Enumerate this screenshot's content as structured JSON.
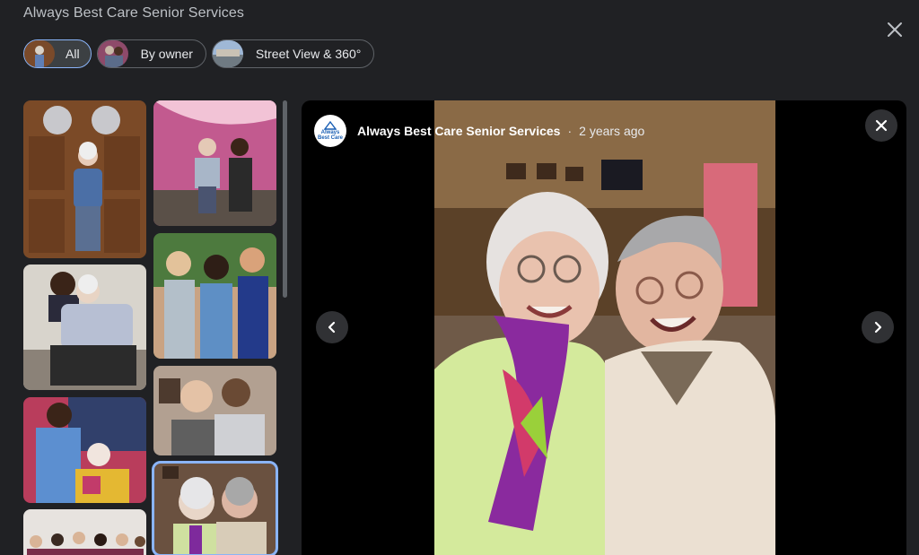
{
  "header": {
    "title": "Always Best Care Senior Services"
  },
  "filters": [
    {
      "label": "All",
      "active": true
    },
    {
      "label": "By owner",
      "active": false
    },
    {
      "label": "Street View & 360°",
      "active": false
    }
  ],
  "viewer": {
    "owner_name": "Always Best Care Senior Services",
    "separator": "·",
    "posted_age": "2 years ago",
    "logo_line1": "Always",
    "logo_line2": "Best Care"
  },
  "colors": {
    "background": "#202124",
    "accent": "#8ab4f8",
    "viewer_bg": "#000000"
  },
  "icons": [
    "close-icon",
    "chevron-left-icon",
    "chevron-right-icon"
  ]
}
